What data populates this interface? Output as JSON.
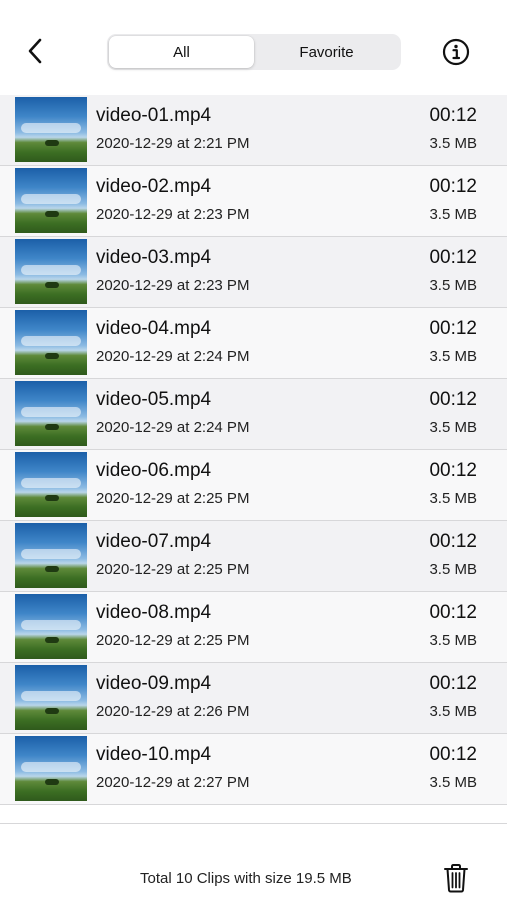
{
  "header": {
    "back_icon": "chevron-left-icon",
    "tabs": [
      {
        "label": "All",
        "active": true
      },
      {
        "label": "Favorite",
        "active": false
      }
    ],
    "info_icon": "info-circle-icon"
  },
  "clips": [
    {
      "name": "video-01.mp4",
      "date": "2020-12-29 at 2:21 PM",
      "duration": "00:12",
      "size": "3.5 MB"
    },
    {
      "name": "video-02.mp4",
      "date": "2020-12-29 at 2:23 PM",
      "duration": "00:12",
      "size": "3.5 MB"
    },
    {
      "name": "video-03.mp4",
      "date": "2020-12-29 at 2:23 PM",
      "duration": "00:12",
      "size": "3.5 MB"
    },
    {
      "name": "video-04.mp4",
      "date": "2020-12-29 at 2:24 PM",
      "duration": "00:12",
      "size": "3.5 MB"
    },
    {
      "name": "video-05.mp4",
      "date": "2020-12-29 at 2:24 PM",
      "duration": "00:12",
      "size": "3.5 MB"
    },
    {
      "name": "video-06.mp4",
      "date": "2020-12-29 at 2:25 PM",
      "duration": "00:12",
      "size": "3.5 MB"
    },
    {
      "name": "video-07.mp4",
      "date": "2020-12-29 at 2:25 PM",
      "duration": "00:12",
      "size": "3.5 MB"
    },
    {
      "name": "video-08.mp4",
      "date": "2020-12-29 at 2:25 PM",
      "duration": "00:12",
      "size": "3.5 MB"
    },
    {
      "name": "video-09.mp4",
      "date": "2020-12-29 at 2:26 PM",
      "duration": "00:12",
      "size": "3.5 MB"
    },
    {
      "name": "video-10.mp4",
      "date": "2020-12-29 at 2:27 PM",
      "duration": "00:12",
      "size": "3.5 MB"
    }
  ],
  "footer": {
    "summary": "Total 10 Clips with size 19.5 MB",
    "trash_icon": "trash-icon"
  },
  "colors": {
    "row_odd": "#f2f2f4",
    "row_even": "#f8f8f9",
    "segment_bg": "#ececee",
    "divider": "#d7d7d9"
  }
}
